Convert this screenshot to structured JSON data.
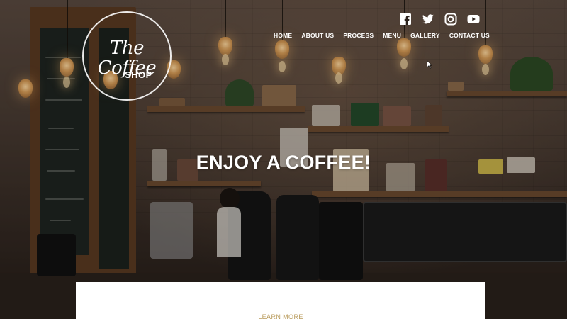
{
  "logo": {
    "title": "The Coffee",
    "subtitle": "SHOP"
  },
  "social": [
    {
      "name": "facebook-icon"
    },
    {
      "name": "twitter-icon"
    },
    {
      "name": "instagram-icon"
    },
    {
      "name": "youtube-icon"
    }
  ],
  "nav": {
    "items": [
      {
        "label": "HOME"
      },
      {
        "label": "ABOUT US"
      },
      {
        "label": "PROCESS"
      },
      {
        "label": "MENU"
      },
      {
        "label": "GALLERY"
      },
      {
        "label": "CONTACT US"
      }
    ]
  },
  "hero": {
    "headline": "ENJOY A COFFEE!"
  },
  "panel": {
    "cta_label": "LEARN MORE"
  },
  "colors": {
    "accent": "#b89a5a",
    "text": "#ffffff",
    "panel": "#ffffff"
  }
}
